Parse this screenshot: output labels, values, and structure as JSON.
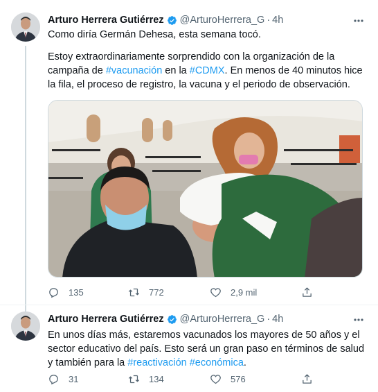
{
  "tweets": [
    {
      "author": {
        "name": "Arturo Herrera Gutiérrez",
        "handle": "@ArturoHerrera_G",
        "separator": "·",
        "time": "4h"
      },
      "text1": "Como diría Germán Dehesa, esta semana tocó.",
      "text2": {
        "part1": "Estoy extraordinariamente  sorprendido con la organización de la campaña de ",
        "hashtag1": "#vacunación",
        "part2": " en la ",
        "hashtag2": "#CDMX",
        "part3": ". En menos de 40 minutos hice la fila, el proceso de registro, la vacuna y el periodo de observación."
      },
      "stats": {
        "replies": "135",
        "retweets": "772",
        "likes": "2,9 mil"
      }
    },
    {
      "author": {
        "name": "Arturo Herrera Gutiérrez",
        "handle": "@ArturoHerrera_G",
        "separator": "·",
        "time": "4h"
      },
      "text": {
        "part1": "En unos días más, estaremos vacunados los mayores de 50 años y el sector educativo del país. Esto será un gran paso en términos de salud y también para la ",
        "hashtag1": "#reactivación",
        "space": " ",
        "hashtag2": "#económica",
        "part2": "."
      },
      "stats": {
        "replies": "31",
        "retweets": "134",
        "likes": "576"
      }
    }
  ],
  "icons": {
    "more": "more-dots-icon",
    "verified": "verified-badge-icon",
    "reply": "reply-icon",
    "retweet": "retweet-icon",
    "like": "heart-icon",
    "share": "share-icon"
  },
  "colors": {
    "accent": "#1d9bf0",
    "text": "#0f1419",
    "secondary": "#536471",
    "border": "#cfd9de"
  }
}
